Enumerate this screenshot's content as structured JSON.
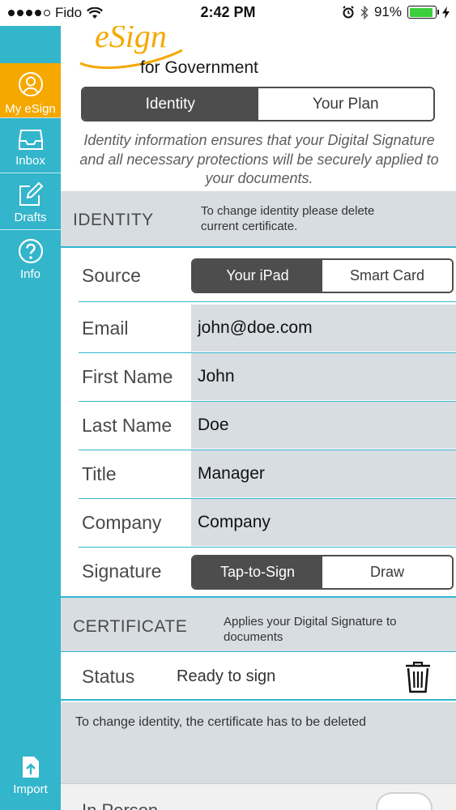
{
  "status_bar": {
    "carrier": "Fido",
    "time": "2:42 PM",
    "battery": "91%",
    "battery_level": 0.91
  },
  "sidebar": {
    "items": [
      {
        "label": "My eSign",
        "icon": "person-circle-icon"
      },
      {
        "label": "Inbox",
        "icon": "inbox-tray-icon"
      },
      {
        "label": "Drafts",
        "icon": "pencil-square-icon"
      },
      {
        "label": "Info",
        "icon": "question-circle-icon"
      }
    ],
    "import_label": "Import"
  },
  "logo": {
    "brand": "eSign",
    "subtitle": "for Government"
  },
  "tabs": {
    "identity": "Identity",
    "plan": "Your Plan",
    "selected": "Identity"
  },
  "intro_text": "Identity information ensures that your Digital Signature and all necessary protections will be securely applied to your documents.",
  "identity_section": {
    "title": "IDENTITY",
    "note": "To change identity please delete current certificate."
  },
  "source": {
    "label": "Source",
    "options": [
      "Your iPad",
      "Smart Card"
    ],
    "selected": "Your iPad"
  },
  "fields": [
    {
      "label": "Email",
      "value": "john@doe.com"
    },
    {
      "label": "First Name",
      "value": "John"
    },
    {
      "label": "Last Name",
      "value": "Doe"
    },
    {
      "label": "Title",
      "value": "Manager"
    },
    {
      "label": "Company",
      "value": "Company"
    }
  ],
  "signature": {
    "label": "Signature",
    "options": [
      "Tap-to-Sign",
      "Draw"
    ],
    "selected": "Tap-to-Sign"
  },
  "certificate_section": {
    "title": "CERTIFICATE",
    "note": "Applies your Digital Signature to documents"
  },
  "status": {
    "label": "Status",
    "value": "Ready to sign",
    "delete_icon": "trash-icon"
  },
  "change_identity_note": "To change identity, the certificate has to be deleted",
  "in_person": {
    "label": "In Person"
  },
  "colors": {
    "sidebar": "#33b5cb",
    "active_tab": "#f5a800",
    "segment_on": "#4d4d4d",
    "field_bg": "#d8dde2",
    "logo": "#f5a800"
  }
}
